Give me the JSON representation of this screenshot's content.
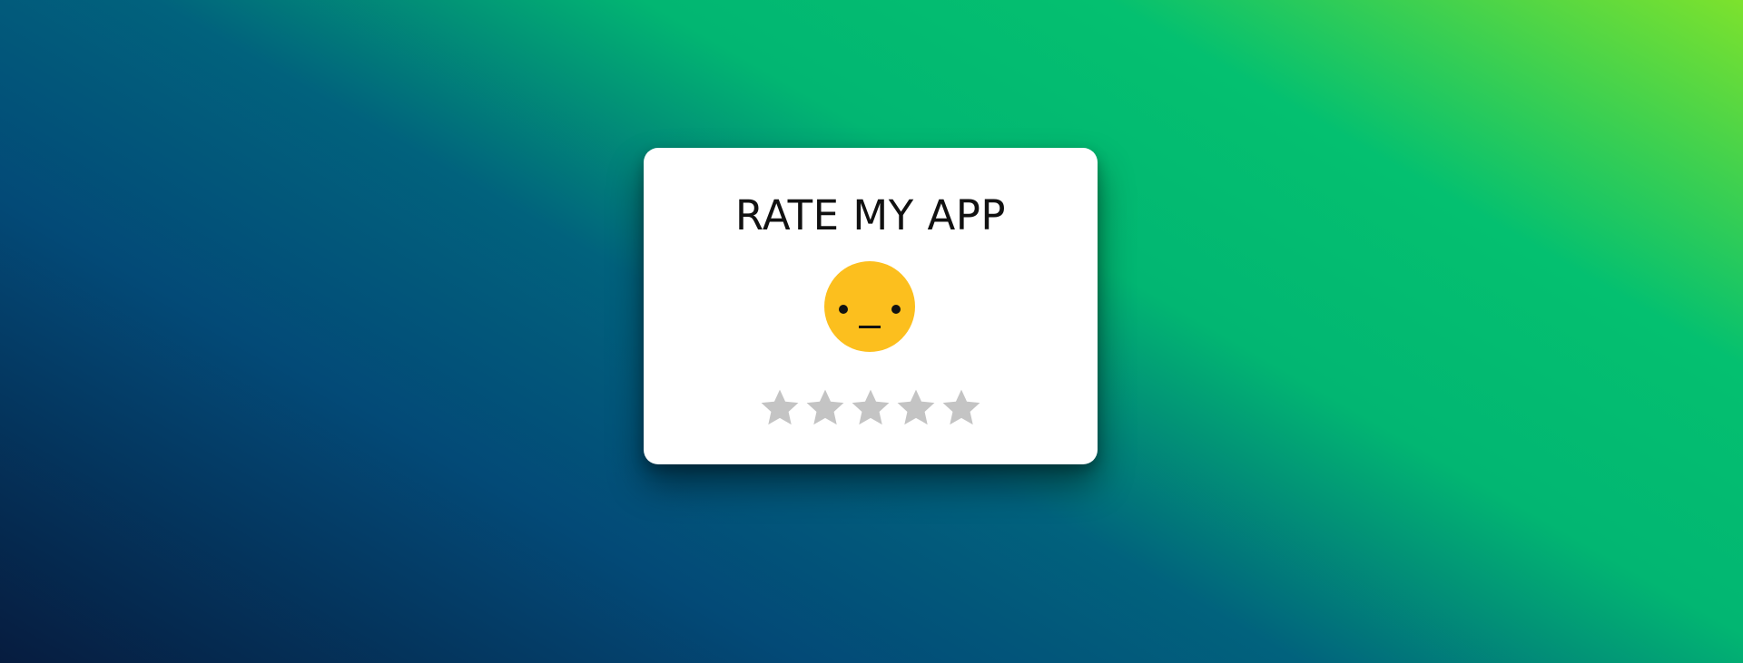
{
  "title": "RATE MY APP",
  "face": {
    "icon": "neutral-face-icon",
    "color": "#fcbf1e"
  },
  "rating": {
    "value": 0,
    "max": 5,
    "star_icon": "star-icon",
    "empty_color": "#c4c4c4",
    "filled_color": "#fcbf1e"
  },
  "colors": {
    "card_background": "#ffffff",
    "text": "#111111"
  }
}
